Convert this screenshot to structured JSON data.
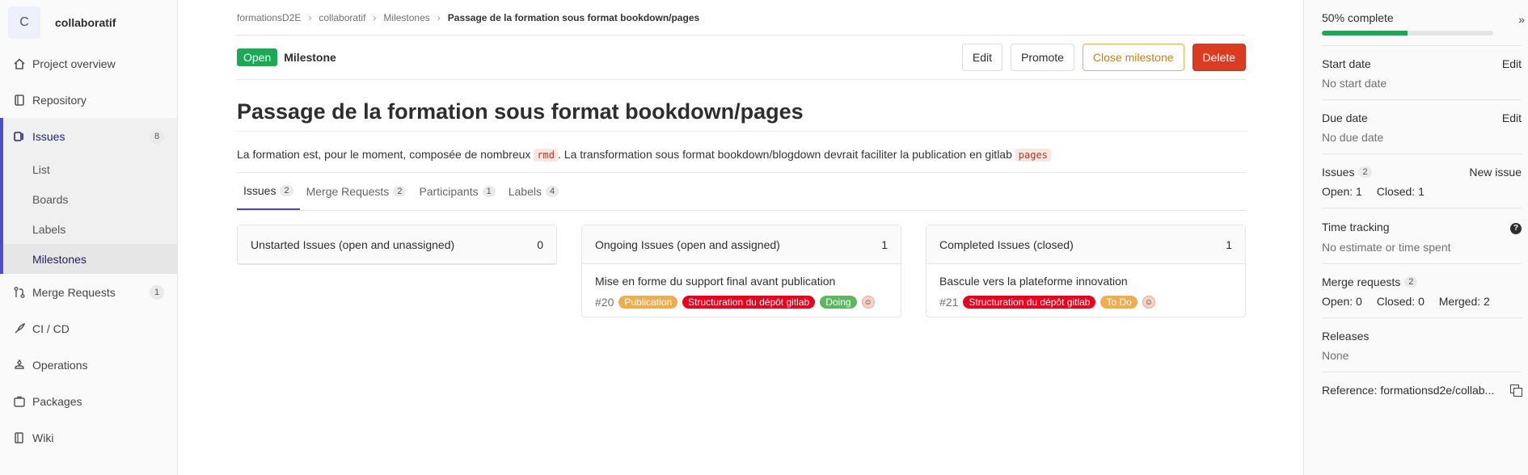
{
  "project": {
    "avatar_letter": "C",
    "name": "collaboratif"
  },
  "nav": {
    "overview": "Project overview",
    "repository": "Repository",
    "issues": {
      "label": "Issues",
      "count": "8"
    },
    "issues_sub": [
      "List",
      "Boards",
      "Labels",
      "Milestones"
    ],
    "merge_requests": {
      "label": "Merge Requests",
      "count": "1"
    },
    "cicd": "CI / CD",
    "operations": "Operations",
    "packages": "Packages",
    "wiki": "Wiki"
  },
  "breadcrumb": [
    "formationsD2E",
    "collaboratif",
    "Milestones",
    "Passage de la formation sous format bookdown/pages"
  ],
  "header": {
    "status": "Open",
    "type": "Milestone",
    "buttons": {
      "edit": "Edit",
      "promote": "Promote",
      "close": "Close milestone",
      "delete": "Delete"
    }
  },
  "milestone": {
    "title": "Passage de la formation sous format bookdown/pages",
    "desc_part1": "La formation est, pour le moment, composée de nombreux",
    "desc_code1": "rmd",
    "desc_part2": ". La transformation sous format bookdown/blogdown devrait faciliter la publication en gitlab",
    "desc_code2": "pages"
  },
  "tabs": [
    {
      "label": "Issues",
      "count": "2"
    },
    {
      "label": "Merge Requests",
      "count": "2"
    },
    {
      "label": "Participants",
      "count": "1"
    },
    {
      "label": "Labels",
      "count": "4"
    }
  ],
  "boards": {
    "unstarted": {
      "title": "Unstarted Issues (open and unassigned)",
      "count": "0"
    },
    "ongoing": {
      "title": "Ongoing Issues (open and assigned)",
      "count": "1",
      "card": {
        "title": "Mise en forme du support final avant publication",
        "iid": "#20",
        "labels": [
          "Publication",
          "Structuration du dépôt gitlab",
          "Doing"
        ]
      }
    },
    "completed": {
      "title": "Completed Issues (closed)",
      "count": "1",
      "card": {
        "title": "Bascule vers la plateforme innovation",
        "iid": "#21",
        "labels": [
          "Structuration du dépôt gitlab",
          "To Do"
        ]
      }
    }
  },
  "label_colors": {
    "Publication": "#f0ad4e",
    "Structuration du dépôt gitlab": "#e8001c",
    "Doing": "#5cb85c",
    "To Do": "#f0ad4e"
  },
  "right": {
    "progress_text": "50% complete",
    "progress_value": 0.5,
    "start_date": {
      "label": "Start date",
      "action": "Edit",
      "value": "No start date"
    },
    "due_date": {
      "label": "Due date",
      "action": "Edit",
      "value": "No due date"
    },
    "issues": {
      "label": "Issues",
      "count": "2",
      "action": "New issue",
      "open": "Open: 1",
      "closed": "Closed: 1"
    },
    "time_tracking": {
      "label": "Time tracking",
      "value": "No estimate or time spent"
    },
    "merge_requests": {
      "label": "Merge requests",
      "count": "2",
      "open": "Open: 0",
      "closed": "Closed: 0",
      "merged": "Merged: 2"
    },
    "releases": {
      "label": "Releases",
      "value": "None"
    },
    "reference": "Reference: formationsd2e/collab..."
  }
}
